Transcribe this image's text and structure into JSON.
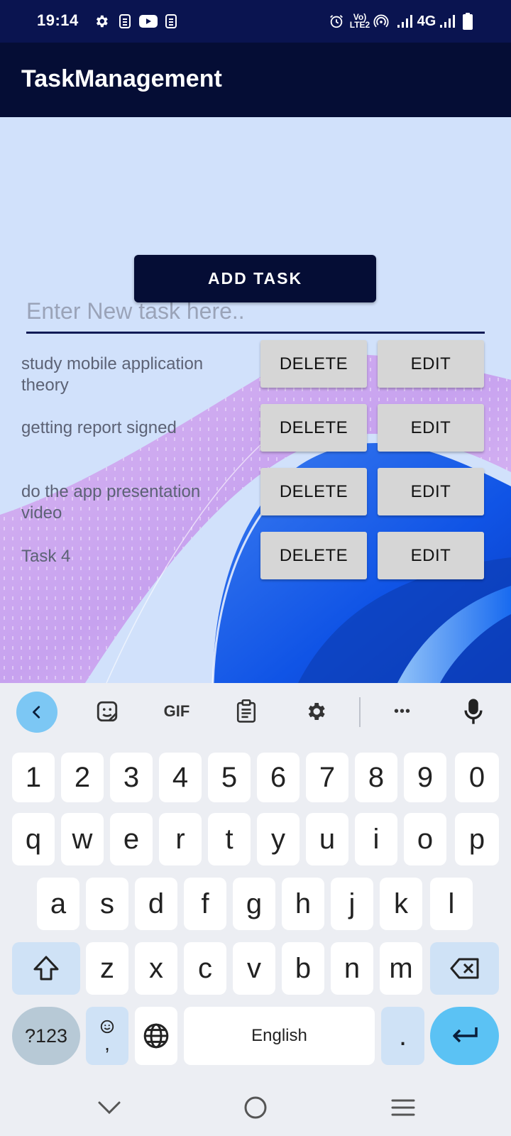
{
  "status_bar": {
    "time": "19:14",
    "network_label": "4G",
    "volte_label": "Vo)\nLTE2",
    "icons": [
      "gear-icon",
      "sim-icon",
      "youtube-icon",
      "sim-icon",
      "alarm-icon",
      "volte-icon",
      "hotspot-icon",
      "signal-icon",
      "signal-icon",
      "battery-icon"
    ]
  },
  "app": {
    "title": "TaskManagement",
    "input_placeholder": "Enter New task here..",
    "input_value": "",
    "add_button": "ADD TASK"
  },
  "tasks": [
    {
      "text": "study mobile application theory",
      "delete_label": "DELETE",
      "edit_label": "EDIT"
    },
    {
      "text": "getting report signed",
      "delete_label": "DELETE",
      "edit_label": "EDIT"
    },
    {
      "text": "do the app presentation video",
      "delete_label": "DELETE",
      "edit_label": "EDIT"
    },
    {
      "text": "Task 4",
      "delete_label": "DELETE",
      "edit_label": "EDIT"
    }
  ],
  "keyboard": {
    "toolbar": [
      "back-icon",
      "sticker-icon",
      "gif-icon",
      "clipboard-icon",
      "settings-icon",
      "more-icon",
      "mic-icon"
    ],
    "gif_label": "GIF",
    "more_label": "•••",
    "row_numbers": [
      "1",
      "2",
      "3",
      "4",
      "5",
      "6",
      "7",
      "8",
      "9",
      "0"
    ],
    "row_top": [
      "q",
      "w",
      "e",
      "r",
      "t",
      "y",
      "u",
      "i",
      "o",
      "p"
    ],
    "row_home": [
      "a",
      "s",
      "d",
      "f",
      "g",
      "h",
      "j",
      "k",
      "l"
    ],
    "row_bottom": [
      "z",
      "x",
      "c",
      "v",
      "b",
      "n",
      "m"
    ],
    "symbols_label": "?123",
    "emoji_comma_label": ",",
    "space_label": "English",
    "period_label": "."
  },
  "nav_bar": [
    "chevron-down-icon",
    "home-circle-icon",
    "menu-icon"
  ],
  "colors": {
    "status_bar_bg": "#0a1450",
    "app_bar_bg": "#050d35",
    "content_bg": "#d1e1fb",
    "button_gray": "#d6d6d6",
    "accent_blue": "#5bc2f4",
    "keyboard_bg": "#eceef3"
  }
}
